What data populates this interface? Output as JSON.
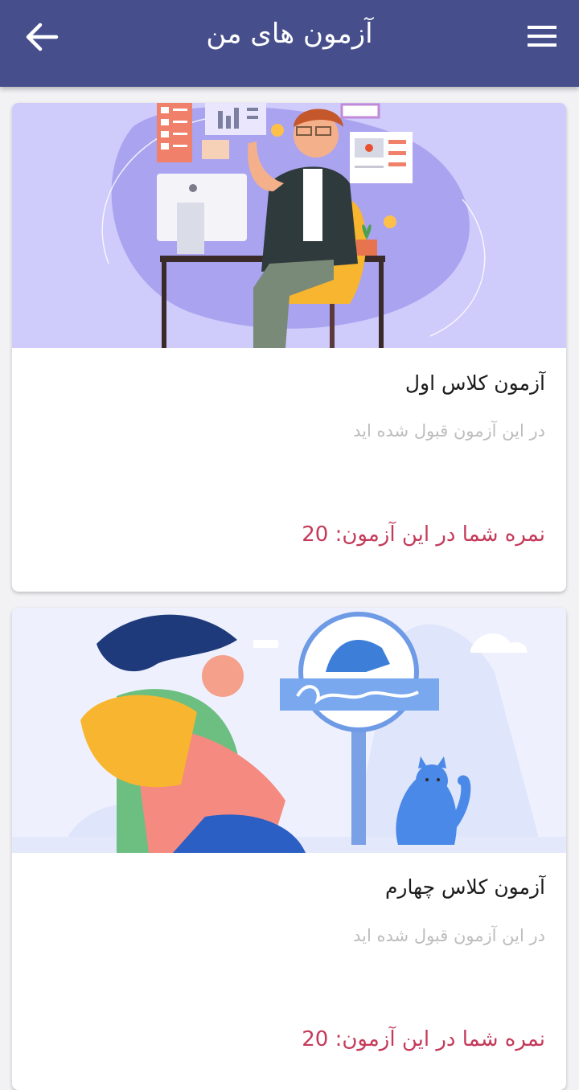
{
  "header": {
    "title": "آزمون های من",
    "back_icon": "arrow-left-icon",
    "menu_icon": "hamburger-menu-icon",
    "background_color": "#464f8c"
  },
  "exams": [
    {
      "title": "آزمون کلاس اول",
      "status": "در این آزمون قبول شده اید",
      "score_text": "نمره شما در این آزمون: 20",
      "illustration": "man-at-computer-illustration"
    },
    {
      "title": "آزمون کلاس چهارم",
      "status": "در این آزمون قبول شده اید",
      "score_text": "نمره شما در این آزمون: 20",
      "illustration": "girl-with-backpack-and-cat-illustration"
    }
  ],
  "colors": {
    "score": "#c43a5a",
    "status": "#bdbdbd",
    "title": "#1c1c1c"
  }
}
